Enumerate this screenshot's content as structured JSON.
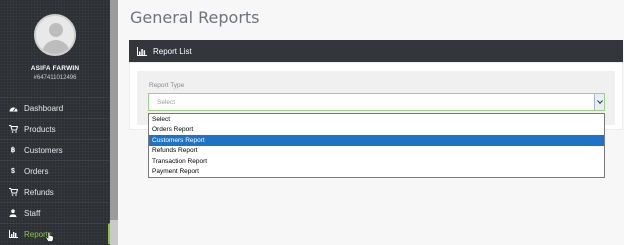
{
  "user": {
    "name": "ASIFA FARWIN",
    "id": "#647411012496"
  },
  "sidebar": {
    "items": [
      {
        "label": "Dashboard",
        "icon": "dashboard-icon",
        "active": false
      },
      {
        "label": "Products",
        "icon": "cart-icon",
        "active": false
      },
      {
        "label": "Customers",
        "icon": "bitcoin-icon",
        "active": false
      },
      {
        "label": "Orders",
        "icon": "dollar-icon",
        "active": false
      },
      {
        "label": "Refunds",
        "icon": "cart-icon",
        "active": false
      },
      {
        "label": "Staff",
        "icon": "user-icon",
        "active": false
      },
      {
        "label": "Reports",
        "icon": "chart-icon",
        "active": true
      }
    ]
  },
  "page": {
    "title": "General Reports"
  },
  "panel": {
    "title": "Report List"
  },
  "form": {
    "label": "Report Type",
    "select_placeholder": "Select",
    "options": [
      "Select",
      "Orders Report",
      "Customers Report",
      "Refunds Report",
      "Transaction Report",
      "Payment Report"
    ],
    "highlighted_option": "Customers Report"
  },
  "colors": {
    "sidebar_bg": "#2c3035",
    "accent": "#8bc34a",
    "highlight": "#1e73c8",
    "panel_header": "#33373b"
  }
}
